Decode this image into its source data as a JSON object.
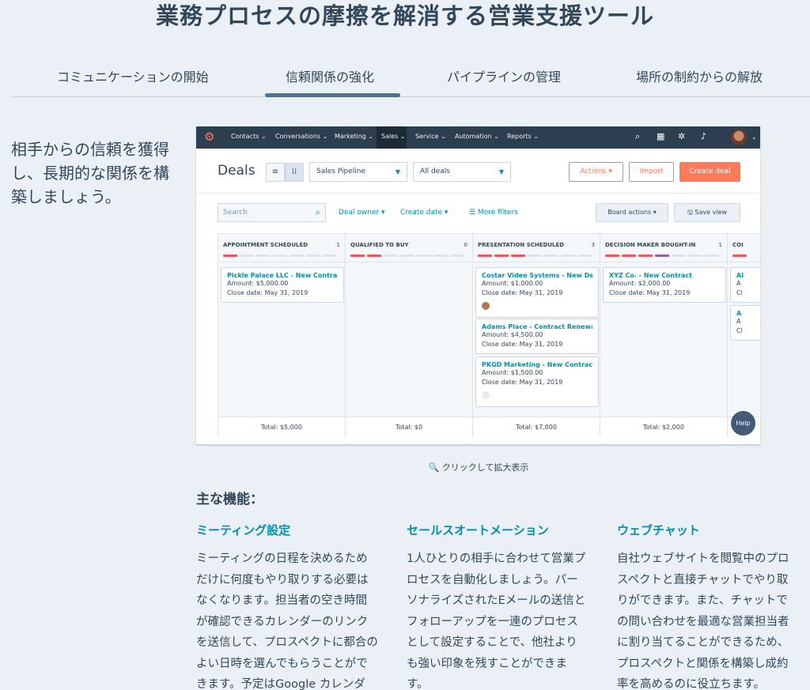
{
  "page_title": "業務プロセスの摩擦を解消する営業支援ツール",
  "tabs": [
    {
      "label": "コミュニケーションの開始",
      "active": false
    },
    {
      "label": "信頼関係の強化",
      "active": true
    },
    {
      "label": "パイプラインの管理",
      "active": false
    },
    {
      "label": "場所の制約からの解放",
      "active": false
    }
  ],
  "lead_text": "相手からの信頼を獲得し、長期的な関係を構築しましょう。",
  "crm": {
    "nav": {
      "items": [
        "Contacts ⌄",
        "Conversations ⌄",
        "Marketing ⌄",
        "Sales ⌄",
        "Service ⌄",
        "Automation ⌄",
        "Reports ⌄"
      ]
    },
    "deals_title": "Deals",
    "pipeline_select": "Sales Pipeline",
    "deals_filter_select": "All deals",
    "actions_button": "Actions ▾",
    "import_button": "Import",
    "create_deal_button": "Create deal",
    "search_placeholder": "Search",
    "filters": {
      "deal_owner": "Deal owner ▾",
      "create_date": "Create date ▾",
      "more_filters": "☰ More filters"
    },
    "board_actions": "Board actions ▾",
    "save_view": "🖫 Save view",
    "columns": [
      {
        "name": "APPOINTMENT SCHEDULED",
        "count": "1",
        "total": "Total: $5,000",
        "cards": [
          {
            "name": "Pickle Palace LLC - New Contract",
            "amount": "Amount: $5,000.00",
            "close": "Close date: May 31, 2019"
          }
        ]
      },
      {
        "name": "QUALIFIED TO BUY",
        "count": "0",
        "total": "Total: $0",
        "cards": []
      },
      {
        "name": "PRESENTATION SCHEDULED",
        "count": "3",
        "total": "Total: $7,000",
        "cards": [
          {
            "name": "Costar Video Systems - New Deal",
            "amount": "Amount: $1,000.00",
            "close": "Close date: May 31, 2019"
          },
          {
            "name": "Adams Place - Contract Renewal",
            "amount": "Amount: $4,500.00",
            "close": "Close date: May 31, 2019"
          },
          {
            "name": "PKGD Marketing - New Contract",
            "amount": "Amount: $1,500.00",
            "close": "Close date: May 31, 2019"
          }
        ]
      },
      {
        "name": "DECISION MAKER BOUGHT-IN",
        "count": "1",
        "total": "Total: $2,000",
        "cards": [
          {
            "name": "XYZ Co. - New Contract",
            "amount": "Amount: $2,000.00",
            "close": "Close date: May 31, 2019"
          }
        ]
      },
      {
        "name": "COI",
        "count": "",
        "total": "",
        "cards": [
          {
            "name": "Al",
            "amount": "A",
            "close": "Cl"
          },
          {
            "name": "A",
            "amount": "A",
            "close": "Cl"
          }
        ]
      }
    ],
    "help_button": "Help"
  },
  "zoom_caption": "🔍 クリックして拡大表示",
  "features_heading": "主な機能：",
  "features": [
    {
      "title": "ミーティング設定",
      "body": "ミーティングの日程を決めるためだけに何度もやり取りする必要はなくなります。担当者の空き時間が確認できるカレンダーのリンクを送信して、プロスペクトに都合のよい日時を選んでもらうことができます。予定はGoogle カレンダ"
    },
    {
      "title": "セールスオートメーション",
      "body": "1人ひとりの相手に合わせて営業プロセスを自動化しましょう。パーソナライズされたEメールの送信とフォローアップを一連のプロセスとして設定することで、他社よりも強い印象を残すことができます。"
    },
    {
      "title": "ウェブチャット",
      "body": "自社ウェブサイトを閲覧中のプロスペクトと直接チャットでやり取りができます。また、チャットでの問い合わせを最適な営業担当者に割り当てることができるため、プロスペクトと関係を構築し成約率を高めるのに役立ちます。"
    }
  ]
}
